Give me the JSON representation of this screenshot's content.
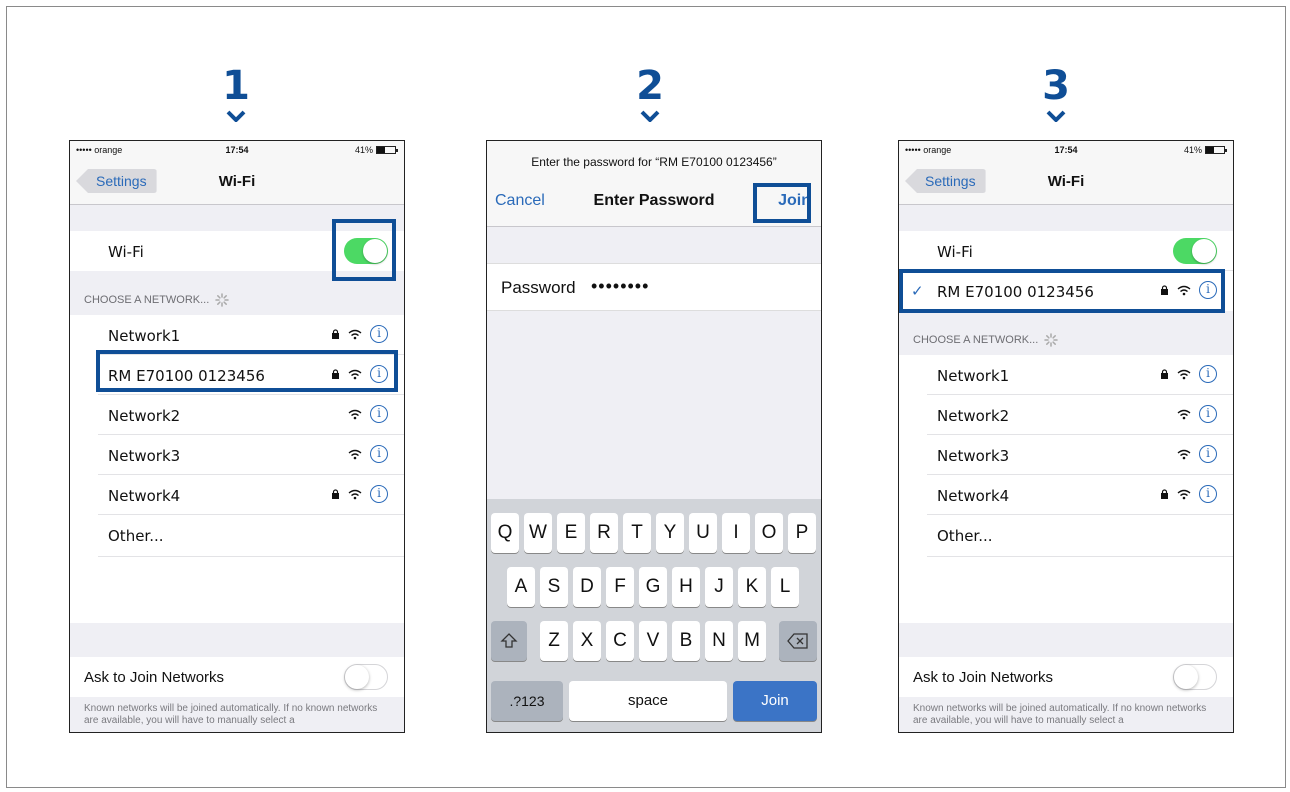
{
  "steps": [
    "1",
    "2",
    "3"
  ],
  "colors": {
    "highlight": "#0f4e96",
    "ios_blue": "#2a6ab9",
    "toggle_on": "#4cd964"
  },
  "screen1": {
    "status": {
      "carrier": "••••• orange",
      "time": "17:54",
      "battery": "41%"
    },
    "back": "Settings",
    "title": "Wi-Fi",
    "wifi_label": "Wi-Fi",
    "wifi_on": true,
    "section_header": "CHOOSE A NETWORK...",
    "networks": [
      {
        "name": "Network1",
        "locked": true
      },
      {
        "name": "RM E70100 0123456",
        "locked": true
      },
      {
        "name": "Network2",
        "locked": false
      },
      {
        "name": "Network3",
        "locked": false
      },
      {
        "name": "Network4",
        "locked": true
      }
    ],
    "other": "Other...",
    "ask_label": "Ask to Join Networks",
    "ask_on": false,
    "footer": "Known networks will be joined automatically. If no known networks are available, you will have to manually select a"
  },
  "screen2": {
    "prompt": "Enter the password for “RM E70100 0123456”",
    "cancel": "Cancel",
    "title": "Enter Password",
    "join": "Join",
    "password_label": "Password",
    "password_value": "••••••••",
    "keyboard": {
      "row1": [
        "Q",
        "W",
        "E",
        "R",
        "T",
        "Y",
        "U",
        "I",
        "O",
        "P"
      ],
      "row2": [
        "A",
        "S",
        "D",
        "F",
        "G",
        "H",
        "J",
        "K",
        "L"
      ],
      "row3": [
        "Z",
        "X",
        "C",
        "V",
        "B",
        "N",
        "M"
      ],
      "shift_icon": "shift-icon",
      "delete_icon": "backspace-icon",
      "numbers": ".?123",
      "space": "space",
      "join": "Join"
    }
  },
  "screen3": {
    "status": {
      "carrier": "••••• orange",
      "time": "17:54",
      "battery": "41%"
    },
    "back": "Settings",
    "title": "Wi-Fi",
    "wifi_label": "Wi-Fi",
    "wifi_on": true,
    "connected": "RM E70100 0123456",
    "section_header": "CHOOSE A NETWORK...",
    "networks": [
      {
        "name": "Network1",
        "locked": true
      },
      {
        "name": "Network2",
        "locked": false
      },
      {
        "name": "Network3",
        "locked": false
      },
      {
        "name": "Network4",
        "locked": true
      }
    ],
    "other": "Other...",
    "ask_label": "Ask to Join Networks",
    "ask_on": false,
    "footer": "Known networks will be joined automatically. If no known networks are available, you will have to manually select a"
  }
}
